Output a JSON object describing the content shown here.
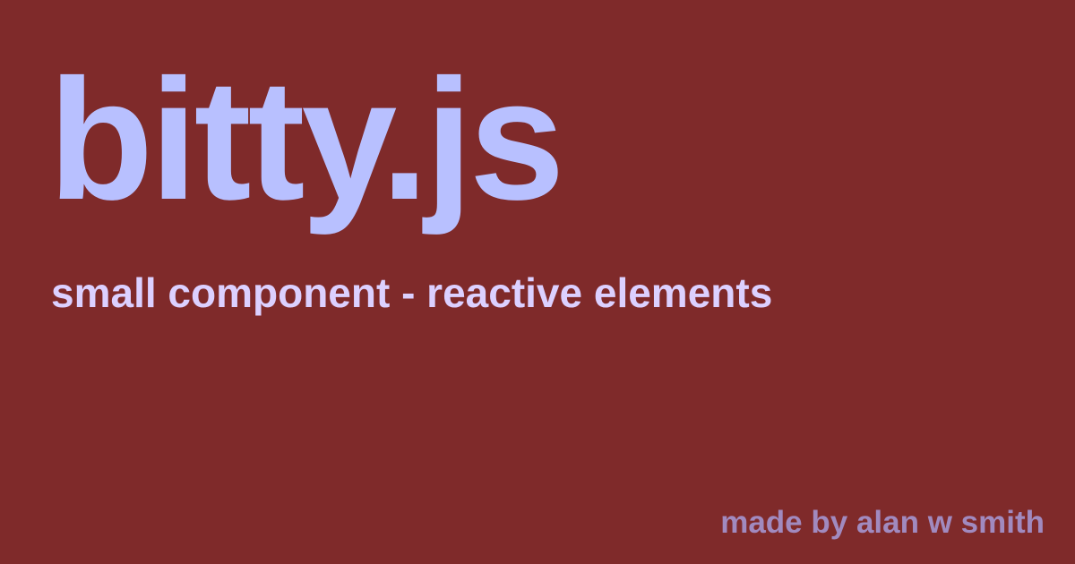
{
  "card": {
    "title": "bitty.js",
    "subtitle": "small component - reactive elements",
    "credit": "made by alan w smith"
  },
  "colors": {
    "background": "#7f2a2a",
    "title": "#b8c0ff",
    "subtitle": "#dcd0ff",
    "credit": "#a18abf"
  }
}
